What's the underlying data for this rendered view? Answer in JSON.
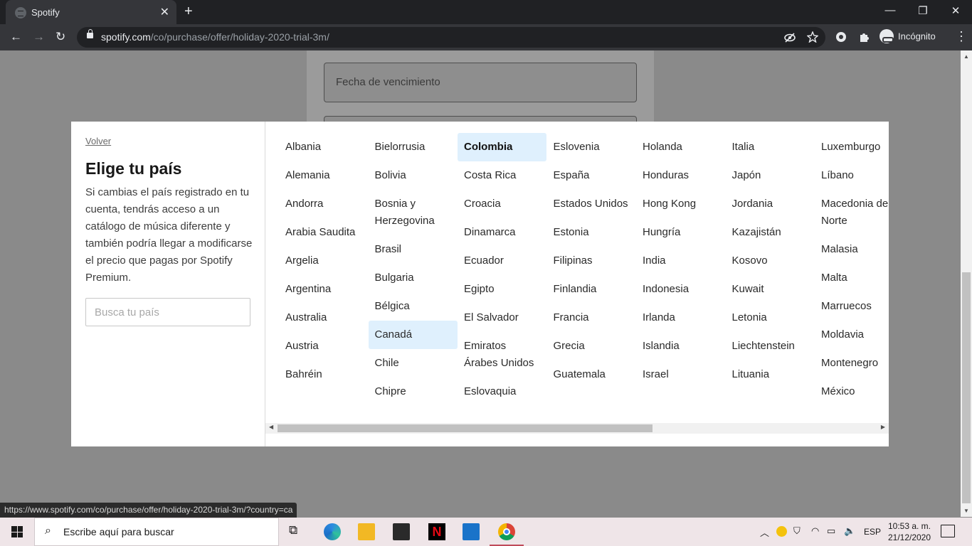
{
  "browser": {
    "tab_title": "Spotify",
    "tab_close": "✕",
    "new_tab": "+",
    "url_host": "spotify.com",
    "url_path": "/co/purchase/offer/holiday-2020-trial-3m/",
    "profile_label": "Incógnito",
    "window_controls": {
      "minimize": "—",
      "restore": "❐",
      "close": "✕"
    },
    "nav": {
      "back": "←",
      "forward": "→",
      "reload": "↻"
    },
    "status_url": "https://www.spotify.com/co/purchase/offer/holiday-2020-trial-3m/?country=ca"
  },
  "page": {
    "expiry_placeholder": "Fecha de vencimiento"
  },
  "modal": {
    "back_link": "Volver",
    "title": "Elige tu país",
    "description": "Si cambias el país registrado en tu cuenta, tendrás acceso a un catálogo de música diferente y también podría llegar a modificarse el precio que pagas por Spotify Premium.",
    "search_placeholder": "Busca tu país",
    "selected_country": "Colombia",
    "hovered_country": "Canadá",
    "columns": [
      [
        "Albania",
        "Alemania",
        "Andorra",
        "Arabia Saudita",
        "Argelia",
        "Argentina",
        "Australia",
        "Austria",
        "Bahréin"
      ],
      [
        "Bielorrusia",
        "Bolivia",
        "Bosnia y Herzegovina",
        "Brasil",
        "Bulgaria",
        "Bélgica",
        "Canadá",
        "Chile",
        "Chipre"
      ],
      [
        "Colombia",
        "Costa Rica",
        "Croacia",
        "Dinamarca",
        "Ecuador",
        "Egipto",
        "El Salvador",
        "Emiratos Árabes Unidos",
        "Eslovaquia"
      ],
      [
        "Eslovenia",
        "España",
        "Estados Unidos",
        "Estonia",
        "Filipinas",
        "Finlandia",
        "Francia",
        "Grecia",
        "Guatemala"
      ],
      [
        "Holanda",
        "Honduras",
        "Hong Kong",
        "Hungría",
        "India",
        "Indonesia",
        "Irlanda",
        "Islandia",
        "Israel"
      ],
      [
        "Italia",
        "Japón",
        "Jordania",
        "Kazajistán",
        "Kosovo",
        "Kuwait",
        "Letonia",
        "Liechtenstein",
        "Lituania"
      ],
      [
        "Luxemburgo",
        "Líbano",
        "Macedonia del Norte",
        "Malasia",
        "Malta",
        "Marruecos",
        "Moldavia",
        "Montenegro",
        "México"
      ]
    ]
  },
  "taskbar": {
    "search_placeholder": "Escribe aquí para buscar",
    "language": "ESP",
    "time": "10:53 a. m.",
    "date": "21/12/2020",
    "netflix_letter": "N"
  }
}
